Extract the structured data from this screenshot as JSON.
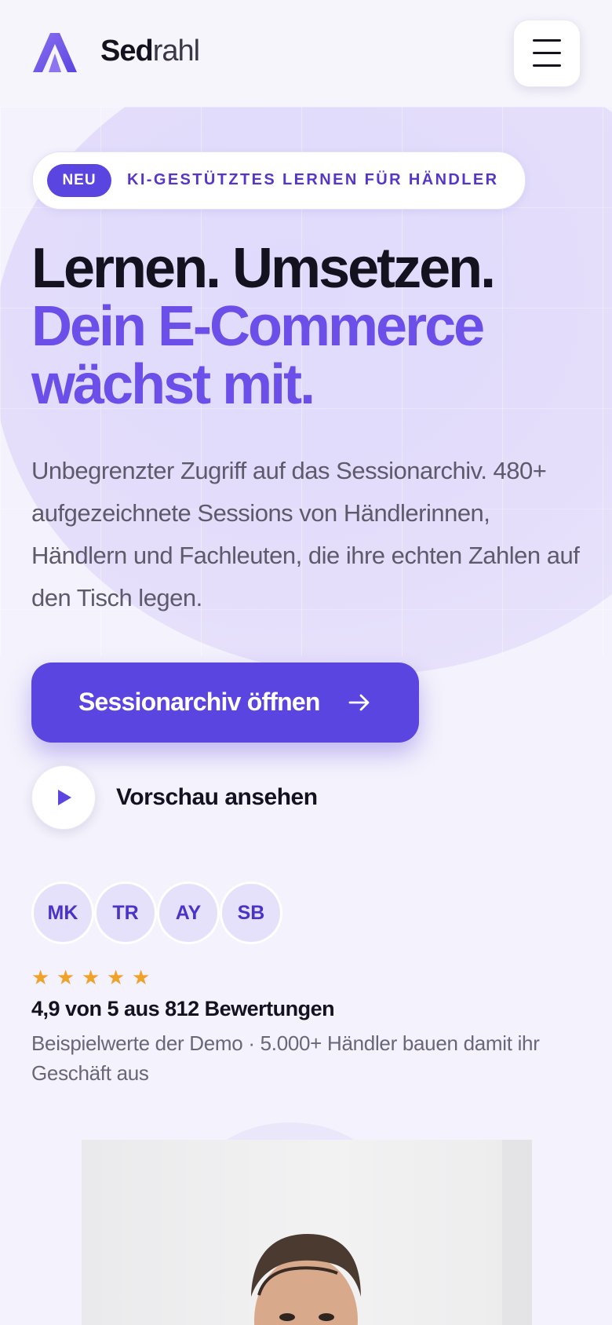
{
  "header": {
    "brand_bold": "Sed",
    "brand_light": "rahl",
    "menu_icon": "hamburger-icon"
  },
  "hero": {
    "badge_pill": "NEU",
    "badge_text": "KI-GESTÜTZTES LERNEN FÜR HÄNDLER",
    "headline_line1": "Lernen. Umsetzen.",
    "headline_line2": "Dein E-Commerce",
    "headline_line3": "wächst mit.",
    "lead": "Unbegrenzter Zugriff auf das Sessionarchiv. 480+ aufgezeichnete Sessions von Händlerinnen, Händlern und Fachleuten, die ihre echten Zahlen auf den Tisch legen.",
    "cta_label": "Sessionarchiv öffnen",
    "preview_label": "Vorschau ansehen"
  },
  "social_proof": {
    "avatars": [
      "MK",
      "TR",
      "AY",
      "SB"
    ],
    "stars": 5,
    "rating_text": "4,9 von 5 aus 812 Bewertungen",
    "note": "Beispielwerte der Demo · 5.000+ Händler bauen damit ihr Geschäft aus"
  },
  "colors": {
    "accent": "#5b45e0",
    "headline_accent": "#6b4fe8",
    "star": "#f0a12a",
    "background": "#f4f2fc"
  }
}
